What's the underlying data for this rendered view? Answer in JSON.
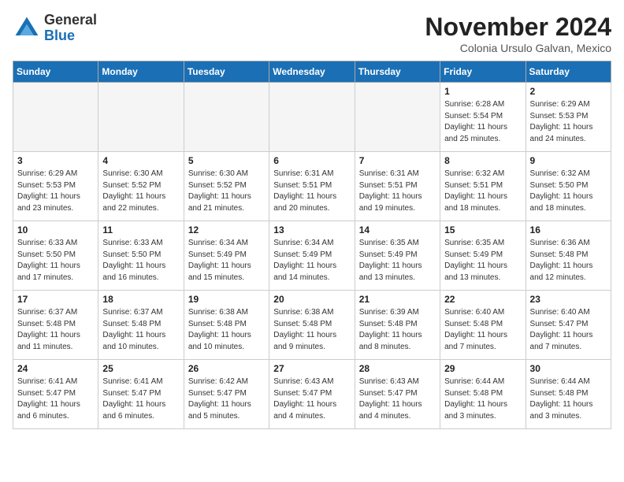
{
  "header": {
    "logo_general": "General",
    "logo_blue": "Blue",
    "month_title": "November 2024",
    "location": "Colonia Ursulo Galvan, Mexico"
  },
  "weekdays": [
    "Sunday",
    "Monday",
    "Tuesday",
    "Wednesday",
    "Thursday",
    "Friday",
    "Saturday"
  ],
  "weeks": [
    [
      {
        "day": "",
        "info": ""
      },
      {
        "day": "",
        "info": ""
      },
      {
        "day": "",
        "info": ""
      },
      {
        "day": "",
        "info": ""
      },
      {
        "day": "",
        "info": ""
      },
      {
        "day": "1",
        "info": "Sunrise: 6:28 AM\nSunset: 5:54 PM\nDaylight: 11 hours\nand 25 minutes."
      },
      {
        "day": "2",
        "info": "Sunrise: 6:29 AM\nSunset: 5:53 PM\nDaylight: 11 hours\nand 24 minutes."
      }
    ],
    [
      {
        "day": "3",
        "info": "Sunrise: 6:29 AM\nSunset: 5:53 PM\nDaylight: 11 hours\nand 23 minutes."
      },
      {
        "day": "4",
        "info": "Sunrise: 6:30 AM\nSunset: 5:52 PM\nDaylight: 11 hours\nand 22 minutes."
      },
      {
        "day": "5",
        "info": "Sunrise: 6:30 AM\nSunset: 5:52 PM\nDaylight: 11 hours\nand 21 minutes."
      },
      {
        "day": "6",
        "info": "Sunrise: 6:31 AM\nSunset: 5:51 PM\nDaylight: 11 hours\nand 20 minutes."
      },
      {
        "day": "7",
        "info": "Sunrise: 6:31 AM\nSunset: 5:51 PM\nDaylight: 11 hours\nand 19 minutes."
      },
      {
        "day": "8",
        "info": "Sunrise: 6:32 AM\nSunset: 5:51 PM\nDaylight: 11 hours\nand 18 minutes."
      },
      {
        "day": "9",
        "info": "Sunrise: 6:32 AM\nSunset: 5:50 PM\nDaylight: 11 hours\nand 18 minutes."
      }
    ],
    [
      {
        "day": "10",
        "info": "Sunrise: 6:33 AM\nSunset: 5:50 PM\nDaylight: 11 hours\nand 17 minutes."
      },
      {
        "day": "11",
        "info": "Sunrise: 6:33 AM\nSunset: 5:50 PM\nDaylight: 11 hours\nand 16 minutes."
      },
      {
        "day": "12",
        "info": "Sunrise: 6:34 AM\nSunset: 5:49 PM\nDaylight: 11 hours\nand 15 minutes."
      },
      {
        "day": "13",
        "info": "Sunrise: 6:34 AM\nSunset: 5:49 PM\nDaylight: 11 hours\nand 14 minutes."
      },
      {
        "day": "14",
        "info": "Sunrise: 6:35 AM\nSunset: 5:49 PM\nDaylight: 11 hours\nand 13 minutes."
      },
      {
        "day": "15",
        "info": "Sunrise: 6:35 AM\nSunset: 5:49 PM\nDaylight: 11 hours\nand 13 minutes."
      },
      {
        "day": "16",
        "info": "Sunrise: 6:36 AM\nSunset: 5:48 PM\nDaylight: 11 hours\nand 12 minutes."
      }
    ],
    [
      {
        "day": "17",
        "info": "Sunrise: 6:37 AM\nSunset: 5:48 PM\nDaylight: 11 hours\nand 11 minutes."
      },
      {
        "day": "18",
        "info": "Sunrise: 6:37 AM\nSunset: 5:48 PM\nDaylight: 11 hours\nand 10 minutes."
      },
      {
        "day": "19",
        "info": "Sunrise: 6:38 AM\nSunset: 5:48 PM\nDaylight: 11 hours\nand 10 minutes."
      },
      {
        "day": "20",
        "info": "Sunrise: 6:38 AM\nSunset: 5:48 PM\nDaylight: 11 hours\nand 9 minutes."
      },
      {
        "day": "21",
        "info": "Sunrise: 6:39 AM\nSunset: 5:48 PM\nDaylight: 11 hours\nand 8 minutes."
      },
      {
        "day": "22",
        "info": "Sunrise: 6:40 AM\nSunset: 5:48 PM\nDaylight: 11 hours\nand 7 minutes."
      },
      {
        "day": "23",
        "info": "Sunrise: 6:40 AM\nSunset: 5:47 PM\nDaylight: 11 hours\nand 7 minutes."
      }
    ],
    [
      {
        "day": "24",
        "info": "Sunrise: 6:41 AM\nSunset: 5:47 PM\nDaylight: 11 hours\nand 6 minutes."
      },
      {
        "day": "25",
        "info": "Sunrise: 6:41 AM\nSunset: 5:47 PM\nDaylight: 11 hours\nand 6 minutes."
      },
      {
        "day": "26",
        "info": "Sunrise: 6:42 AM\nSunset: 5:47 PM\nDaylight: 11 hours\nand 5 minutes."
      },
      {
        "day": "27",
        "info": "Sunrise: 6:43 AM\nSunset: 5:47 PM\nDaylight: 11 hours\nand 4 minutes."
      },
      {
        "day": "28",
        "info": "Sunrise: 6:43 AM\nSunset: 5:47 PM\nDaylight: 11 hours\nand 4 minutes."
      },
      {
        "day": "29",
        "info": "Sunrise: 6:44 AM\nSunset: 5:48 PM\nDaylight: 11 hours\nand 3 minutes."
      },
      {
        "day": "30",
        "info": "Sunrise: 6:44 AM\nSunset: 5:48 PM\nDaylight: 11 hours\nand 3 minutes."
      }
    ]
  ]
}
